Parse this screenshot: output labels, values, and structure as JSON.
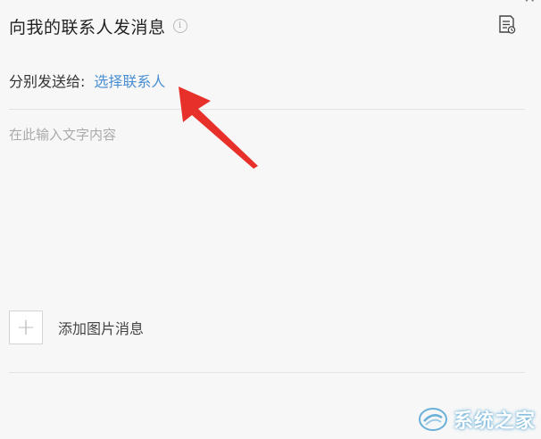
{
  "header": {
    "title": "向我的联系人发消息",
    "info_icon": "i"
  },
  "recipient": {
    "label": "分别发送给:",
    "select_link": "选择联系人"
  },
  "message": {
    "placeholder": "在此输入文字内容"
  },
  "add_image": {
    "plus": "+",
    "label": "添加图片消息"
  },
  "watermark": {
    "text": "系统之家"
  },
  "colors": {
    "link": "#4a8fd1",
    "arrow": "#e8302b",
    "placeholder": "#aaaaaa"
  },
  "icons": {
    "info": "info-icon",
    "note": "note-list-icon",
    "close": "close-icon",
    "add": "plus-icon"
  }
}
